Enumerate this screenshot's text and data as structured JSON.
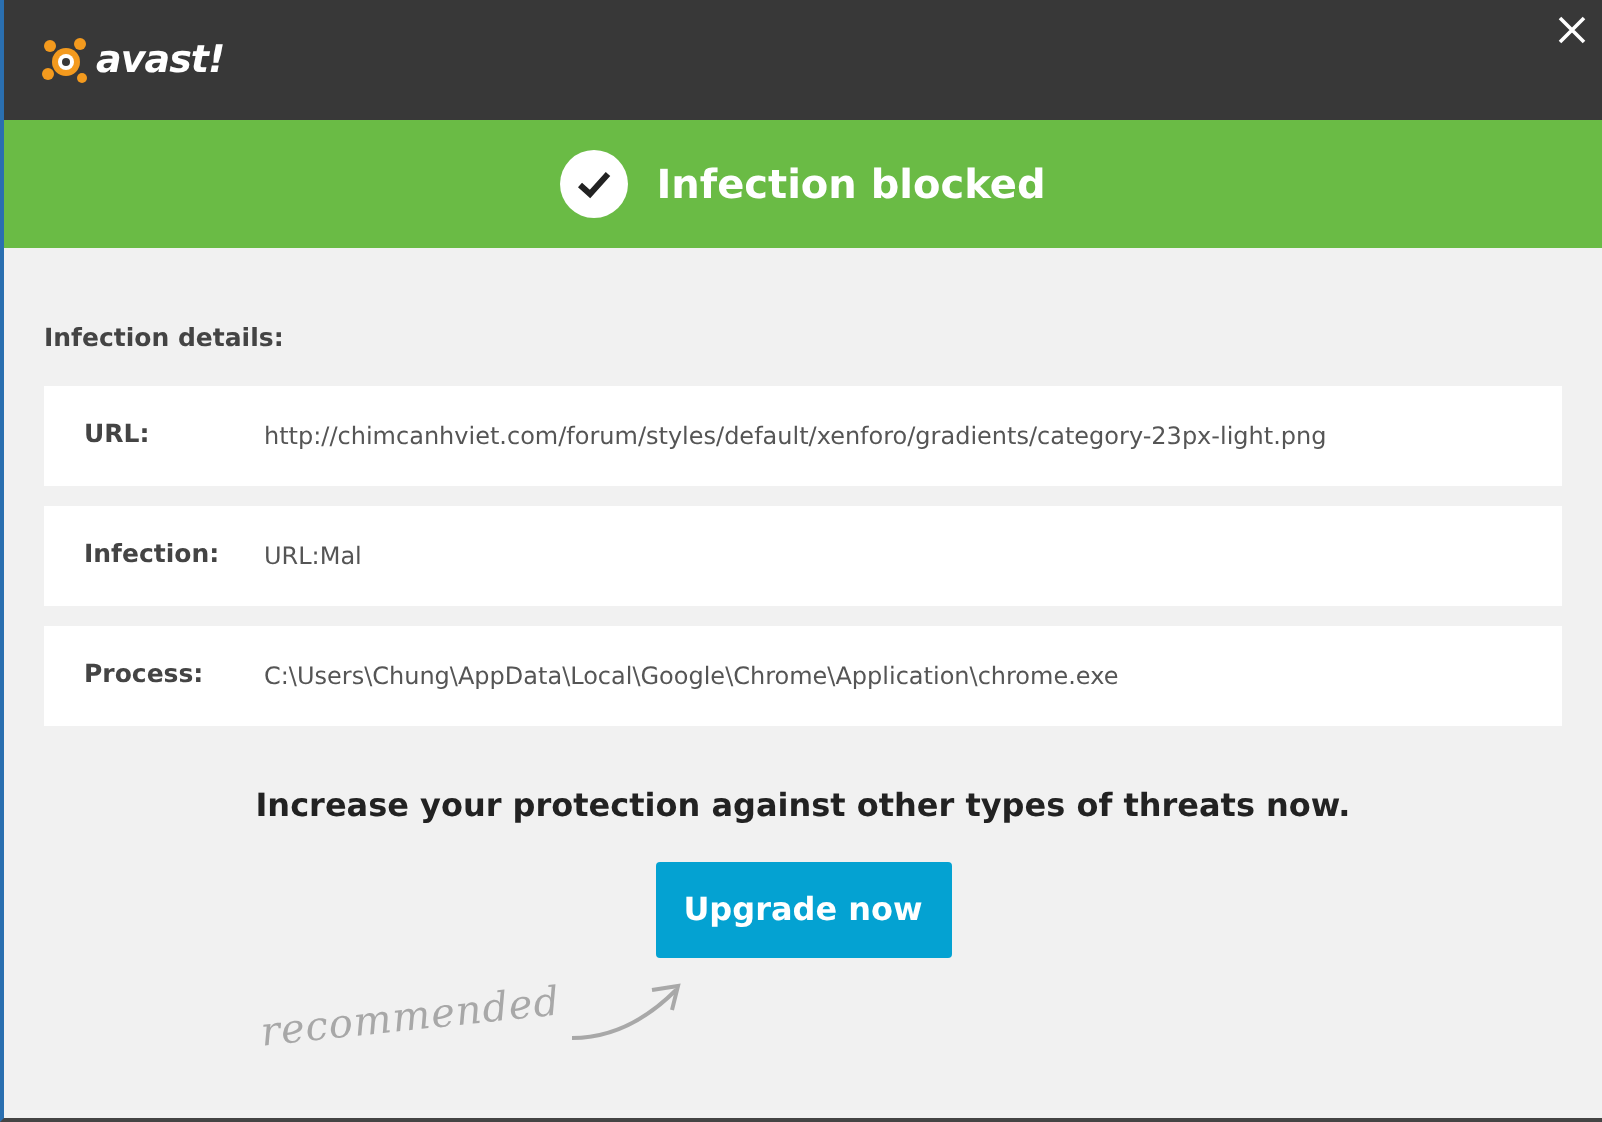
{
  "header": {
    "logo": "avast!"
  },
  "banner": {
    "title": "Infection blocked"
  },
  "details": {
    "heading": "Infection details:",
    "rows": [
      {
        "label": "URL:",
        "value": "http://chimcanhviet.com/forum/styles/default/xenforo/gradients/category-23px-light.png"
      },
      {
        "label": "Infection:",
        "value": "URL:Mal"
      },
      {
        "label": "Process:",
        "value": "C:\\Users\\Chung\\AppData\\Local\\Google\\Chrome\\Application\\chrome.exe"
      }
    ]
  },
  "promo": {
    "message": "Increase your protection against other types of threats now.",
    "button": "Upgrade now",
    "note": "recommended"
  }
}
